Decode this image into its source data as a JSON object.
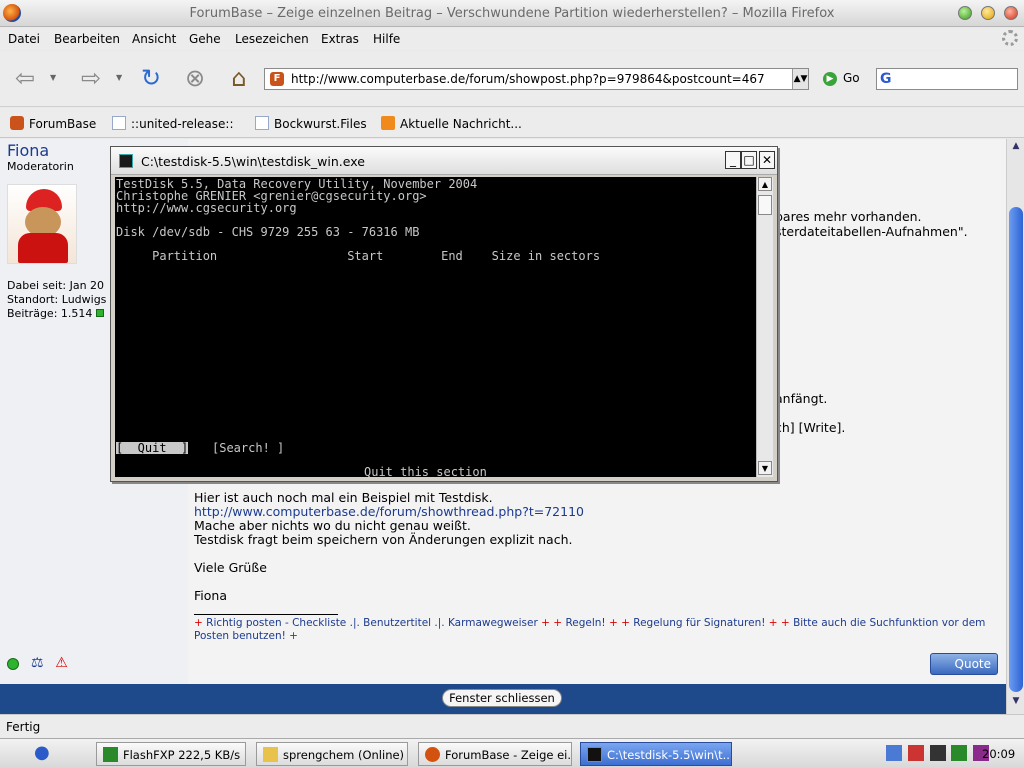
{
  "window": {
    "title": "ForumBase – Zeige einzelnen Beitrag – Verschwundene Partition wiederherstellen? – Mozilla Firefox"
  },
  "menu": [
    "Datei",
    "Bearbeiten",
    "Ansicht",
    "Gehe",
    "Lesezeichen",
    "Extras",
    "Hilfe"
  ],
  "nav": {
    "url": "http://www.computerbase.de/forum/showpost.php?p=979864&postcount=467",
    "go_label": "Go",
    "search_value": ""
  },
  "bookmarks": [
    "ForumBase",
    "::united-release::",
    "Bockwurst.Files",
    "Aktuelle Nachricht..."
  ],
  "post": {
    "username": "Fiona",
    "role": "Moderatorin",
    "info": [
      "Dabei seit: Jan 20",
      "Standort: Ludwigs",
      "Beiträge: 1.514"
    ],
    "behind_text": [
      "bares mehr vorhanden.",
      "sterdateitabellen-Aufnahmen\".",
      "anfängt.",
      "ch] [Write]."
    ],
    "body_lines": [
      "Hier ist auch noch mal ein Beispiel mit Testdisk.",
      "http://www.computerbase.de/forum/showthread.php?t=72110",
      "Mache aber nichts wo du nicht genau weißt.",
      "Testdisk fragt beim speichern von Änderungen explizit nach.",
      "Viele Grüße",
      "Fiona"
    ],
    "signature": [
      "Richtig posten - Checkliste .|. Benutzertitel .|. Karmawegweiser",
      "Regeln!",
      "Regelung für Signaturen!",
      "Bitte auch die Suchfunktion vor dem Posten benutzen!"
    ],
    "quote_label": "Quote",
    "close_label": "Fenster schliessen"
  },
  "console": {
    "title": "C:\\testdisk-5.5\\win\\testdisk_win.exe",
    "lines": [
      "TestDisk 5.5, Data Recovery Utility, November 2004",
      "Christophe GRENIER <grenier@cgsecurity.org>",
      "http://www.cgsecurity.org",
      "Disk /dev/sdb - CHS 9729 255 63 - 76316 MB",
      "     Partition                  Start        End    Size in sectors"
    ],
    "menu_quit": "[  Quit  ]",
    "menu_search": "[Search! ]",
    "hint": "Quit this section"
  },
  "status": "Fertig",
  "taskbar": {
    "tasks": [
      "FlashFXP 222,5 KB/s ...",
      "sprengchem (Online) ...",
      "ForumBase - Zeige ei...",
      "C:\\testdisk-5.5\\win\\t..."
    ],
    "clock": "20:09"
  }
}
